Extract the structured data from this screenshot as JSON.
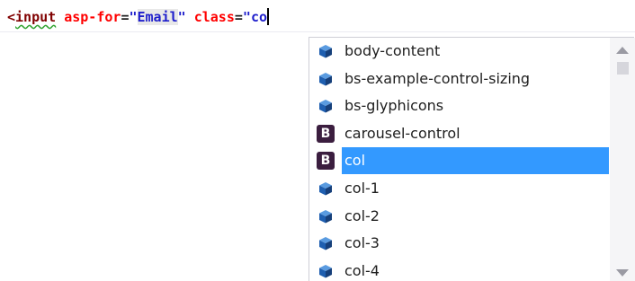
{
  "editor": {
    "tokens": {
      "open": "<",
      "tag": "input",
      "sp1": " ",
      "attr1": "asp-for",
      "eq1": "=",
      "q1": "\"",
      "val1": "Email",
      "q2": "\"",
      "sp2": " ",
      "attr2": "class",
      "eq2": "=",
      "q3": "\"",
      "typed": "co"
    }
  },
  "completion": {
    "selected_index": 4,
    "items": [
      {
        "label": "body-content",
        "icon": "blue-cube-icon"
      },
      {
        "label": "bs-example-control-sizing",
        "icon": "blue-cube-icon"
      },
      {
        "label": "bs-glyphicons",
        "icon": "blue-cube-icon"
      },
      {
        "label": "carousel-control",
        "icon": "bootstrap-b-icon"
      },
      {
        "label": "col",
        "icon": "bootstrap-b-icon"
      },
      {
        "label": "col-1",
        "icon": "blue-cube-icon"
      },
      {
        "label": "col-2",
        "icon": "blue-cube-icon"
      },
      {
        "label": "col-3",
        "icon": "blue-cube-icon"
      },
      {
        "label": "col-4",
        "icon": "blue-cube-icon"
      }
    ],
    "bootstrap_letter": "B",
    "scroll_position": 0.0
  },
  "colors": {
    "selection": "#3399ff",
    "cube": "#1f5fb0",
    "bootstrap": "#3b1e3f"
  }
}
